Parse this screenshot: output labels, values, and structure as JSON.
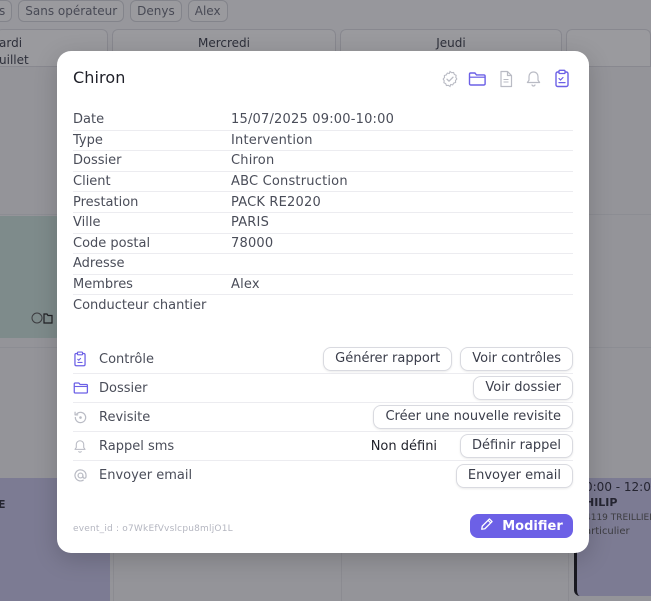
{
  "filters": [
    "s",
    "Sans opérateur",
    "Denys",
    "Alex"
  ],
  "calendar": {
    "days": [
      {
        "label": "ardi",
        "sub": "uillet"
      },
      {
        "label": "Mercredi",
        "sub": ""
      },
      {
        "label": "Jeudi",
        "sub": ""
      },
      {
        "label": "",
        "sub": ""
      }
    ],
    "events": {
      "left_label": "E",
      "right_time": "0:00 - 12:00",
      "right_name": "HILIP",
      "right_addr": "4119 TREILLIER",
      "right_type": "articulier"
    }
  },
  "modal": {
    "title": "Chiron",
    "header_icons": [
      "check-circle-icon",
      "folder-icon",
      "document-icon",
      "bell-icon",
      "clipboard-check-icon"
    ],
    "details": [
      {
        "key": "Date",
        "value": "15/07/2025 09:00-10:00"
      },
      {
        "key": "Type",
        "value": "Intervention"
      },
      {
        "key": "Dossier",
        "value": "Chiron"
      },
      {
        "key": "Client",
        "value": "ABC Construction"
      },
      {
        "key": "Prestation",
        "value": "PACK RE2020"
      },
      {
        "key": "Ville",
        "value": "PARIS"
      },
      {
        "key": "Code postal",
        "value": "78000"
      },
      {
        "key": "Adresse",
        "value": ""
      },
      {
        "key": "Membres",
        "value": "Alex"
      },
      {
        "key": "Conducteur chantier",
        "value": ""
      }
    ],
    "actions": {
      "controle": {
        "label": "Contrôle",
        "btn1": "Générer rapport",
        "btn2": "Voir contrôles"
      },
      "dossier": {
        "label": "Dossier",
        "btn": "Voir dossier"
      },
      "revisite": {
        "label": "Revisite",
        "btn": "Créer une nouvelle revisite"
      },
      "rappel": {
        "label": "Rappel sms",
        "status": "Non défini",
        "btn": "Définir rappel"
      },
      "email": {
        "label": "Envoyer email",
        "btn": "Envoyer email"
      }
    },
    "event_id": "event_id : o7WkEfVvslcpu8mljO1L",
    "modify_label": "Modifier"
  },
  "colors": {
    "accent": "#6c60e6",
    "icon_active": "#6c60e6",
    "icon_muted": "#b9bbc4"
  }
}
